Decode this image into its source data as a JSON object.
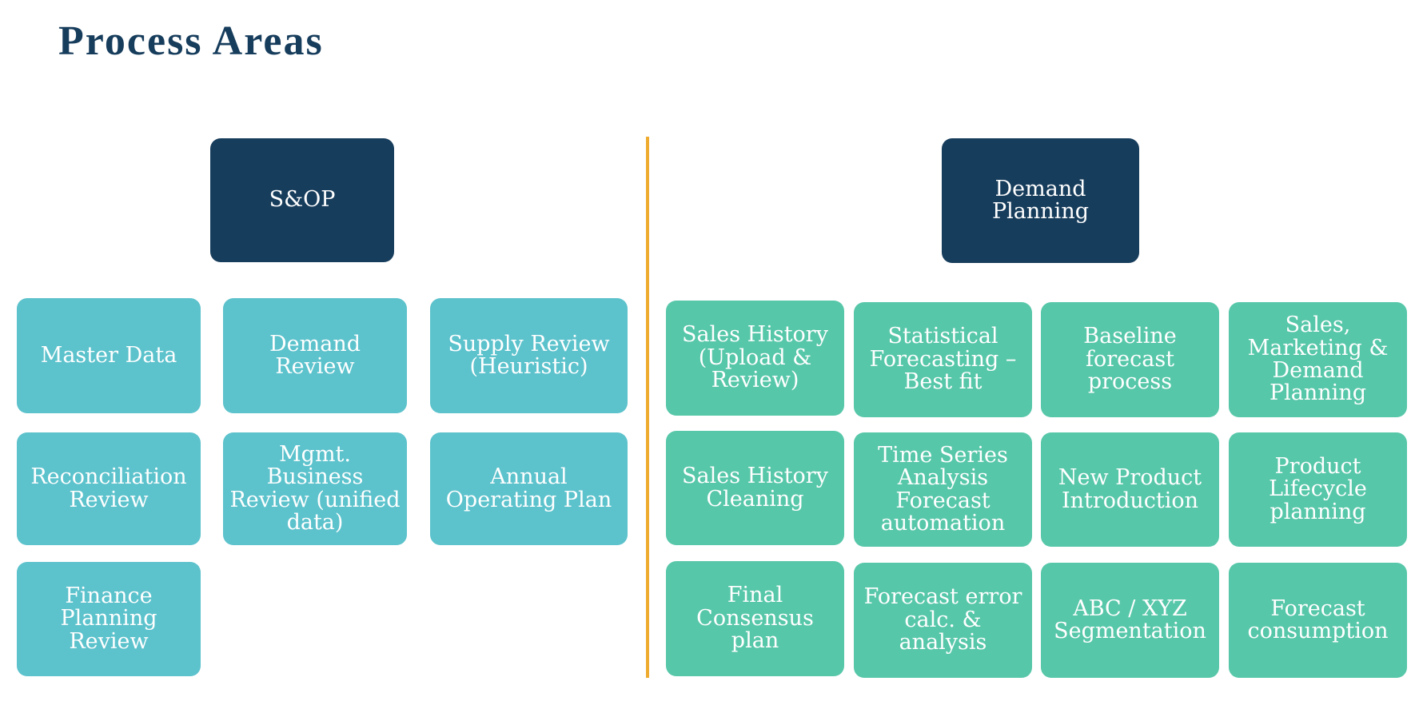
{
  "title": "Process Areas",
  "colors": {
    "title": "#173d5c",
    "header_box": "#173d5c",
    "sop_box": "#5cc2cc",
    "demand_planning_box": "#57c7a9",
    "divider": "#eeab2e"
  },
  "sop": {
    "header": "S&OP",
    "items": [
      "Master Data",
      "Demand Review",
      "Supply Review (Heuristic)",
      "Reconciliation Review",
      "Mgmt. Business Review (unified data)",
      "Annual Operating Plan",
      "Finance Planning Review"
    ]
  },
  "demand_planning": {
    "header": "Demand Planning",
    "items": [
      "Sales History (Upload & Review)",
      "Statistical Forecasting – Best fit",
      "Baseline forecast process",
      "Sales, Marketing & Demand Planning",
      "Sales History Cleaning",
      "Time Series Analysis Forecast automation",
      "New Product Introduction",
      "Product Lifecycle planning",
      "Final Consensus plan",
      "Forecast error calc. & analysis",
      "ABC / XYZ Segmentation",
      "Forecast consumption"
    ]
  }
}
